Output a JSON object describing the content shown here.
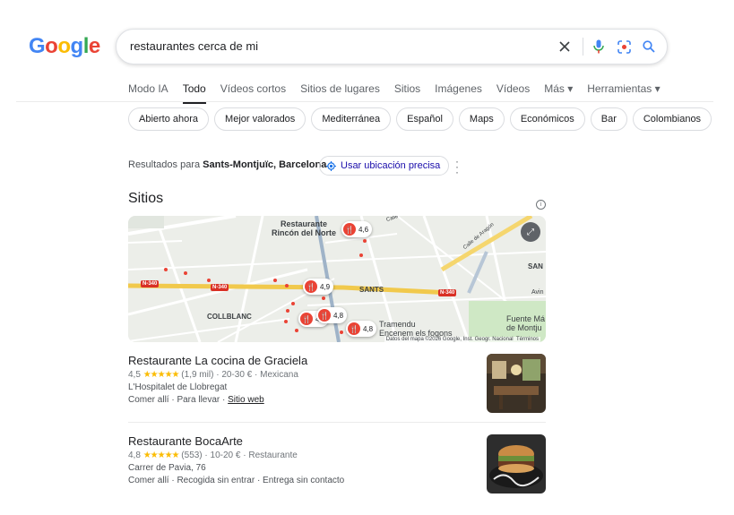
{
  "logo": {
    "letters": [
      "G",
      "o",
      "o",
      "g",
      "l",
      "e"
    ],
    "colors": [
      "#4285f4",
      "#ea4335",
      "#fbbc05",
      "#4285f4",
      "#34a853",
      "#ea4335"
    ]
  },
  "search": {
    "query": "restaurantes cerca de mi",
    "icons": [
      "close-icon",
      "mic-icon",
      "lens-icon",
      "search-icon"
    ]
  },
  "tabs": [
    {
      "label": "Modo IA",
      "active": false
    },
    {
      "label": "Todo",
      "active": true
    },
    {
      "label": "Vídeos cortos",
      "active": false
    },
    {
      "label": "Sitios de lugares",
      "active": false
    },
    {
      "label": "Sitios",
      "active": false
    },
    {
      "label": "Imágenes",
      "active": false
    },
    {
      "label": "Vídeos",
      "active": false
    },
    {
      "label": "Más ▾",
      "active": false
    },
    {
      "label": "Herramientas ▾",
      "active": false
    }
  ],
  "chips": [
    "Abierto ahora",
    "Mejor valorados",
    "Mediterránea",
    "Español",
    "Maps",
    "Económicos",
    "Bar",
    "Colombianos"
  ],
  "results_for": {
    "prefix": "Resultados para",
    "location": "Sants-Montjuïc, Barcelona",
    "button": "Usar ubicación precisa"
  },
  "section_title": "Sitios",
  "map": {
    "labels": {
      "rincon": "Restaurante\nRincón del Norte",
      "sants": "SANTS",
      "collblanc": "COLLBLANC",
      "tramendu": "Tramendu\nEncenem els fogons",
      "fuente": "Fuente Má\nde Montju",
      "san": "SAN",
      "avin": "Avin",
      "calle_aragon": "Calle de Aragón",
      "calle": "Calle"
    },
    "road_tags": [
      "N-340",
      "N-340",
      "N-340"
    ],
    "pins": {
      "p1": "4,6",
      "p2": "4,9",
      "p3": "4,5",
      "p4": "4,8",
      "p5": "4,8"
    },
    "attribution": "Datos del mapa ©2026 Google, Inst. Geogr. Nacional",
    "terms": "Términos"
  },
  "places": [
    {
      "name": "Restaurante La cocina de Graciela",
      "rating": "4,5",
      "stars": "★★★★★",
      "reviews": "(1,9 mil)",
      "price": "20-30 €",
      "category": "Mexicana",
      "address": "L'Hospitalet de Llobregat",
      "services": "Comer allí · Para llevar ·",
      "website": "Sitio web"
    },
    {
      "name": "Restaurante BocaArte",
      "rating": "4,8",
      "stars": "★★★★★",
      "reviews": "(553)",
      "price": "10-20 €",
      "category": "Restaurante",
      "address": "Carrer de Pavia, 76",
      "services": "Comer allí · Recogida sin entrar · Entrega sin contacto"
    }
  ]
}
